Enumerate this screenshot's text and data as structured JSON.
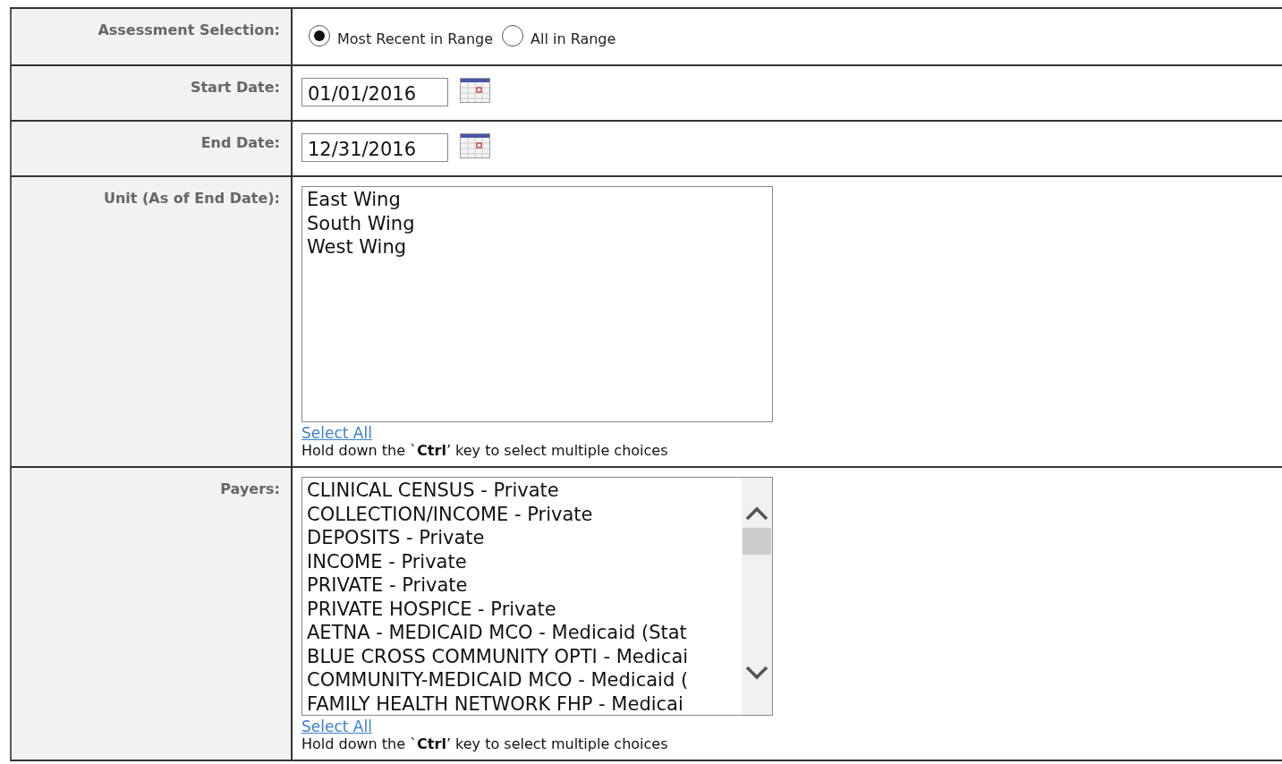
{
  "form": {
    "rows": [
      {
        "kind": "radio",
        "label": "Assessment Selection:",
        "options": [
          {
            "label": "Most Recent in Range",
            "selected": true
          },
          {
            "label": "All in Range",
            "selected": false
          }
        ]
      },
      {
        "kind": "date",
        "label": "Start Date:",
        "value": "01/01/2016"
      },
      {
        "kind": "date",
        "label": "End Date:",
        "value": "12/31/2016"
      },
      {
        "kind": "listbox",
        "label": "Unit (As of End Date):",
        "scrollbar": false,
        "items": [
          "East Wing",
          "South Wing",
          "West Wing"
        ],
        "link": "Select All",
        "hint": "Hold down the `**Ctrl**’ key to select multiple choices"
      },
      {
        "kind": "listbox",
        "label": "Payers:",
        "scrollbar": true,
        "items": [
          "CLINICAL CENSUS - Private",
          "COLLECTION/INCOME - Private",
          "DEPOSITS - Private",
          "INCOME - Private",
          "PRIVATE - Private",
          "PRIVATE HOSPICE - Private",
          "AETNA - MEDICAID MCO - Medicaid (Stat",
          "BLUE CROSS COMMUNITY OPTI - Medicai",
          "COMMUNITY-MEDICAID MCO - Medicaid (",
          "FAMILY HEALTH NETWORK FHP - Medicai"
        ],
        "link": "Select All",
        "hint": "Hold down the `**Ctrl**’ key to select multiple choices"
      }
    ]
  }
}
